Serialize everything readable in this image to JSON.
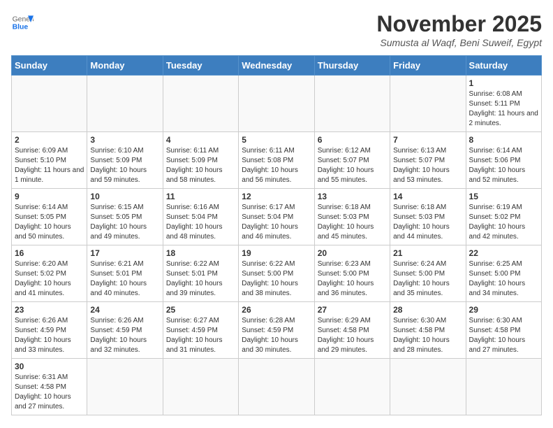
{
  "header": {
    "logo": {
      "general": "General",
      "blue": "Blue"
    },
    "title": "November 2025",
    "location": "Sumusta al Waqf, Beni Suweif, Egypt"
  },
  "calendar": {
    "days_of_week": [
      "Sunday",
      "Monday",
      "Tuesday",
      "Wednesday",
      "Thursday",
      "Friday",
      "Saturday"
    ],
    "weeks": [
      [
        {
          "day": "",
          "info": ""
        },
        {
          "day": "",
          "info": ""
        },
        {
          "day": "",
          "info": ""
        },
        {
          "day": "",
          "info": ""
        },
        {
          "day": "",
          "info": ""
        },
        {
          "day": "",
          "info": ""
        },
        {
          "day": "1",
          "info": "Sunrise: 6:08 AM\nSunset: 5:11 PM\nDaylight: 11 hours and 2 minutes."
        }
      ],
      [
        {
          "day": "2",
          "info": "Sunrise: 6:09 AM\nSunset: 5:10 PM\nDaylight: 11 hours and 1 minute."
        },
        {
          "day": "3",
          "info": "Sunrise: 6:10 AM\nSunset: 5:09 PM\nDaylight: 10 hours and 59 minutes."
        },
        {
          "day": "4",
          "info": "Sunrise: 6:11 AM\nSunset: 5:09 PM\nDaylight: 10 hours and 58 minutes."
        },
        {
          "day": "5",
          "info": "Sunrise: 6:11 AM\nSunset: 5:08 PM\nDaylight: 10 hours and 56 minutes."
        },
        {
          "day": "6",
          "info": "Sunrise: 6:12 AM\nSunset: 5:07 PM\nDaylight: 10 hours and 55 minutes."
        },
        {
          "day": "7",
          "info": "Sunrise: 6:13 AM\nSunset: 5:07 PM\nDaylight: 10 hours and 53 minutes."
        },
        {
          "day": "8",
          "info": "Sunrise: 6:14 AM\nSunset: 5:06 PM\nDaylight: 10 hours and 52 minutes."
        }
      ],
      [
        {
          "day": "9",
          "info": "Sunrise: 6:14 AM\nSunset: 5:05 PM\nDaylight: 10 hours and 50 minutes."
        },
        {
          "day": "10",
          "info": "Sunrise: 6:15 AM\nSunset: 5:05 PM\nDaylight: 10 hours and 49 minutes."
        },
        {
          "day": "11",
          "info": "Sunrise: 6:16 AM\nSunset: 5:04 PM\nDaylight: 10 hours and 48 minutes."
        },
        {
          "day": "12",
          "info": "Sunrise: 6:17 AM\nSunset: 5:04 PM\nDaylight: 10 hours and 46 minutes."
        },
        {
          "day": "13",
          "info": "Sunrise: 6:18 AM\nSunset: 5:03 PM\nDaylight: 10 hours and 45 minutes."
        },
        {
          "day": "14",
          "info": "Sunrise: 6:18 AM\nSunset: 5:03 PM\nDaylight: 10 hours and 44 minutes."
        },
        {
          "day": "15",
          "info": "Sunrise: 6:19 AM\nSunset: 5:02 PM\nDaylight: 10 hours and 42 minutes."
        }
      ],
      [
        {
          "day": "16",
          "info": "Sunrise: 6:20 AM\nSunset: 5:02 PM\nDaylight: 10 hours and 41 minutes."
        },
        {
          "day": "17",
          "info": "Sunrise: 6:21 AM\nSunset: 5:01 PM\nDaylight: 10 hours and 40 minutes."
        },
        {
          "day": "18",
          "info": "Sunrise: 6:22 AM\nSunset: 5:01 PM\nDaylight: 10 hours and 39 minutes."
        },
        {
          "day": "19",
          "info": "Sunrise: 6:22 AM\nSunset: 5:00 PM\nDaylight: 10 hours and 38 minutes."
        },
        {
          "day": "20",
          "info": "Sunrise: 6:23 AM\nSunset: 5:00 PM\nDaylight: 10 hours and 36 minutes."
        },
        {
          "day": "21",
          "info": "Sunrise: 6:24 AM\nSunset: 5:00 PM\nDaylight: 10 hours and 35 minutes."
        },
        {
          "day": "22",
          "info": "Sunrise: 6:25 AM\nSunset: 5:00 PM\nDaylight: 10 hours and 34 minutes."
        }
      ],
      [
        {
          "day": "23",
          "info": "Sunrise: 6:26 AM\nSunset: 4:59 PM\nDaylight: 10 hours and 33 minutes."
        },
        {
          "day": "24",
          "info": "Sunrise: 6:26 AM\nSunset: 4:59 PM\nDaylight: 10 hours and 32 minutes."
        },
        {
          "day": "25",
          "info": "Sunrise: 6:27 AM\nSunset: 4:59 PM\nDaylight: 10 hours and 31 minutes."
        },
        {
          "day": "26",
          "info": "Sunrise: 6:28 AM\nSunset: 4:59 PM\nDaylight: 10 hours and 30 minutes."
        },
        {
          "day": "27",
          "info": "Sunrise: 6:29 AM\nSunset: 4:58 PM\nDaylight: 10 hours and 29 minutes."
        },
        {
          "day": "28",
          "info": "Sunrise: 6:30 AM\nSunset: 4:58 PM\nDaylight: 10 hours and 28 minutes."
        },
        {
          "day": "29",
          "info": "Sunrise: 6:30 AM\nSunset: 4:58 PM\nDaylight: 10 hours and 27 minutes."
        }
      ],
      [
        {
          "day": "30",
          "info": "Sunrise: 6:31 AM\nSunset: 4:58 PM\nDaylight: 10 hours and 27 minutes."
        },
        {
          "day": "",
          "info": ""
        },
        {
          "day": "",
          "info": ""
        },
        {
          "day": "",
          "info": ""
        },
        {
          "day": "",
          "info": ""
        },
        {
          "day": "",
          "info": ""
        },
        {
          "day": "",
          "info": ""
        }
      ]
    ]
  }
}
